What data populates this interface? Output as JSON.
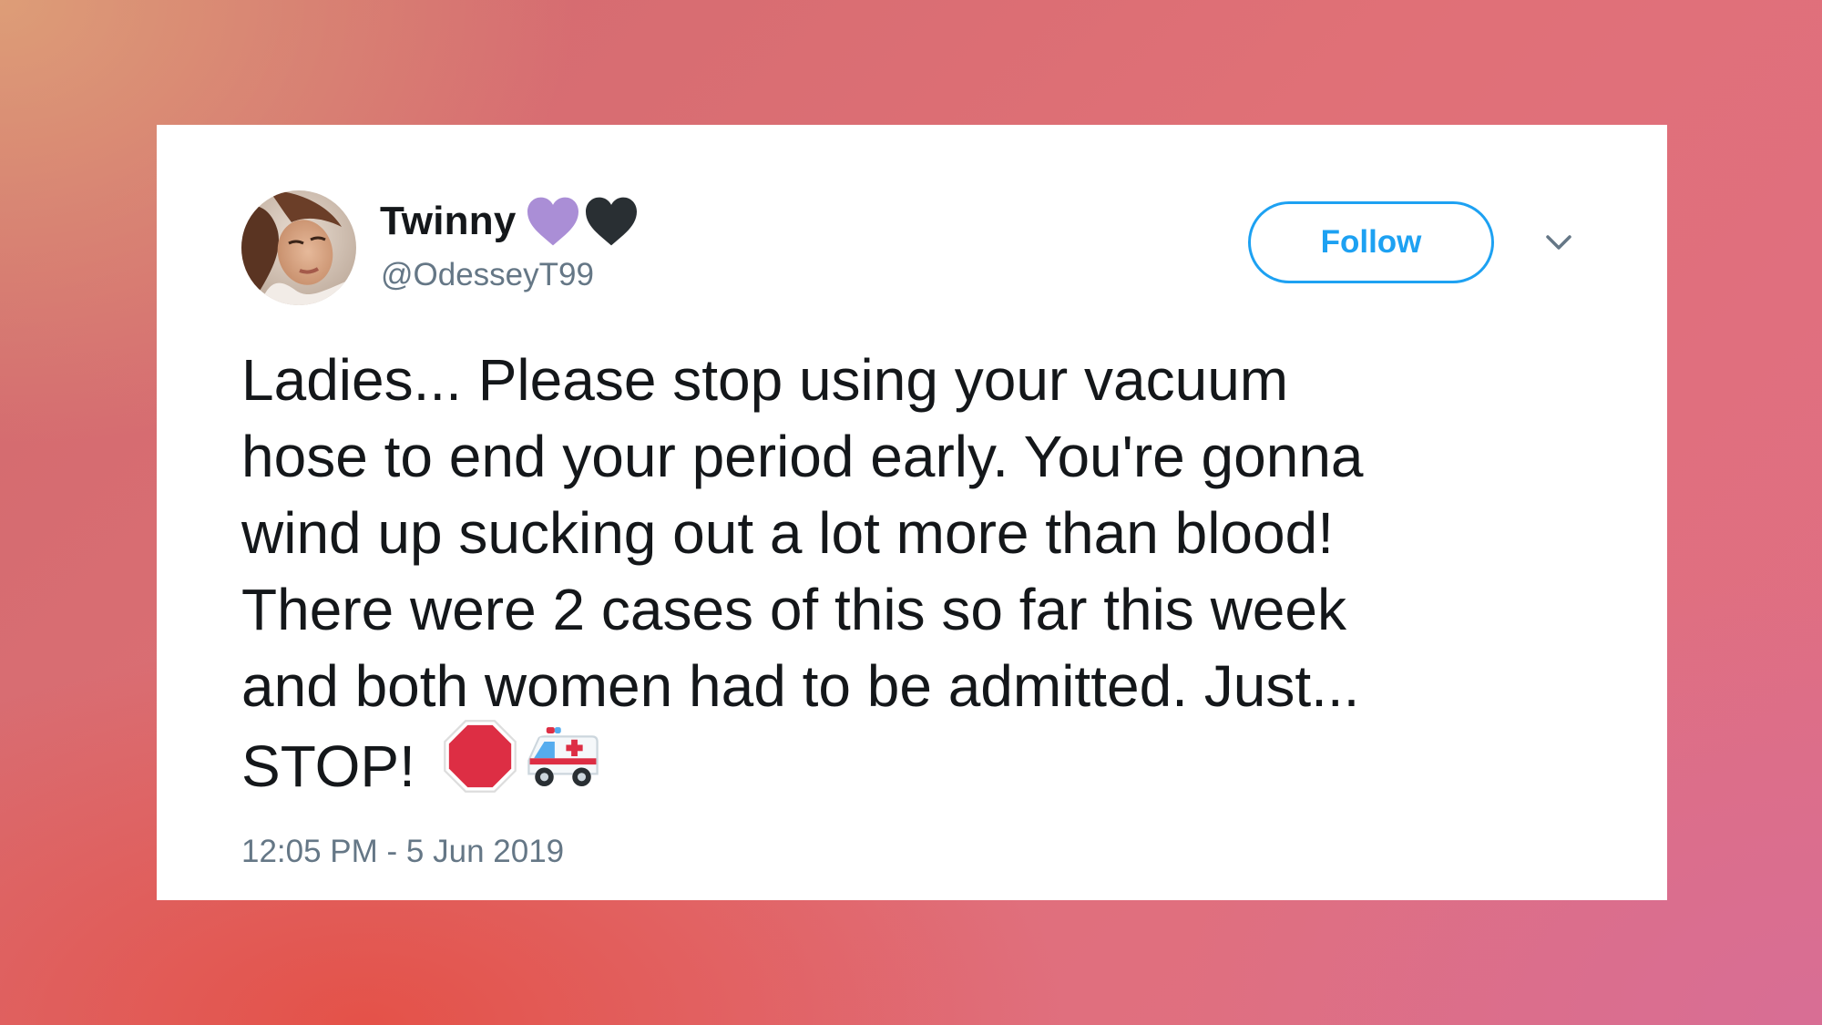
{
  "tweet": {
    "display_name": "Twinny",
    "name_emojis": [
      "purple-heart-icon",
      "black-heart-icon"
    ],
    "handle": "@OdesseyT99",
    "follow_label": "Follow",
    "menu_icon": "chevron-down-icon",
    "text_lines": [
      "Ladies... Please stop using your vacuum",
      "hose to end your period early. You're gonna",
      "wind up sucking out a lot more than blood!",
      "There were 2 cases of this so far this week",
      "and both women had to be admitted. Just...",
      "STOP!"
    ],
    "text_emojis": [
      "stop-sign-icon",
      "ambulance-icon"
    ],
    "timestamp": "12:05 PM - 5 Jun 2019"
  },
  "colors": {
    "accent": "#1da1f2",
    "text": "#14171a",
    "secondary_text": "#657786",
    "purple_heart": "#aa8ed6",
    "black_heart": "#292f33",
    "stop_sign": "#dd2e44"
  }
}
